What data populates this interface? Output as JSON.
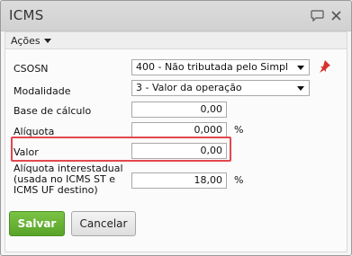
{
  "dialog": {
    "title": "ICMS",
    "icons": {
      "comment": "speech-bubble-icon",
      "close": "close-icon"
    }
  },
  "toolbar": {
    "actions_label": "Ações"
  },
  "form": {
    "csosn": {
      "label": "CSOSN",
      "value": "400 - Não tributada pelo Simpl",
      "pin_icon": "pin-icon"
    },
    "modalidade": {
      "label": "Modalidade",
      "value": "3 - Valor da operação"
    },
    "base_calculo": {
      "label": "Base de cálculo",
      "value": "0,00"
    },
    "aliquota": {
      "label": "Alíquota",
      "value": "0,000",
      "unit": "%"
    },
    "valor": {
      "label": "Valor",
      "value": "0,00"
    },
    "aliquota_interestadual": {
      "label": "Alíquota interestadual (usada no ICMS ST e ICMS UF destino)",
      "value": "18,00",
      "unit": "%"
    }
  },
  "buttons": {
    "save_label": "Salvar",
    "cancel_label": "Cancelar"
  },
  "colors": {
    "save_green": "#6db33f",
    "highlight_red": "#e3474c",
    "pin_red": "#d7332f"
  }
}
